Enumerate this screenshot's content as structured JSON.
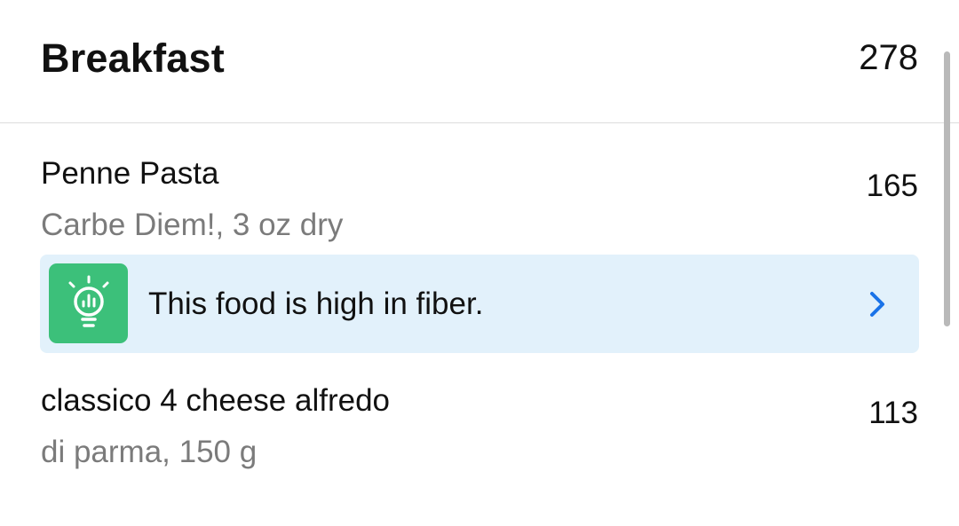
{
  "meal": {
    "title": "Breakfast",
    "total_calories": "278"
  },
  "items": [
    {
      "name": "Penne Pasta",
      "detail": "Carbe Diem!, 3 oz dry",
      "calories": "165"
    },
    {
      "name": "classico 4 cheese alfredo",
      "detail": "di parma, 150 g",
      "calories": "113"
    }
  ],
  "insight": {
    "text": "This food is high in fiber.",
    "icon": "lightbulb-icon",
    "icon_bg_color": "#3cc07a",
    "banner_bg_color": "#e2f1fb",
    "chevron_color": "#1a73e8"
  }
}
